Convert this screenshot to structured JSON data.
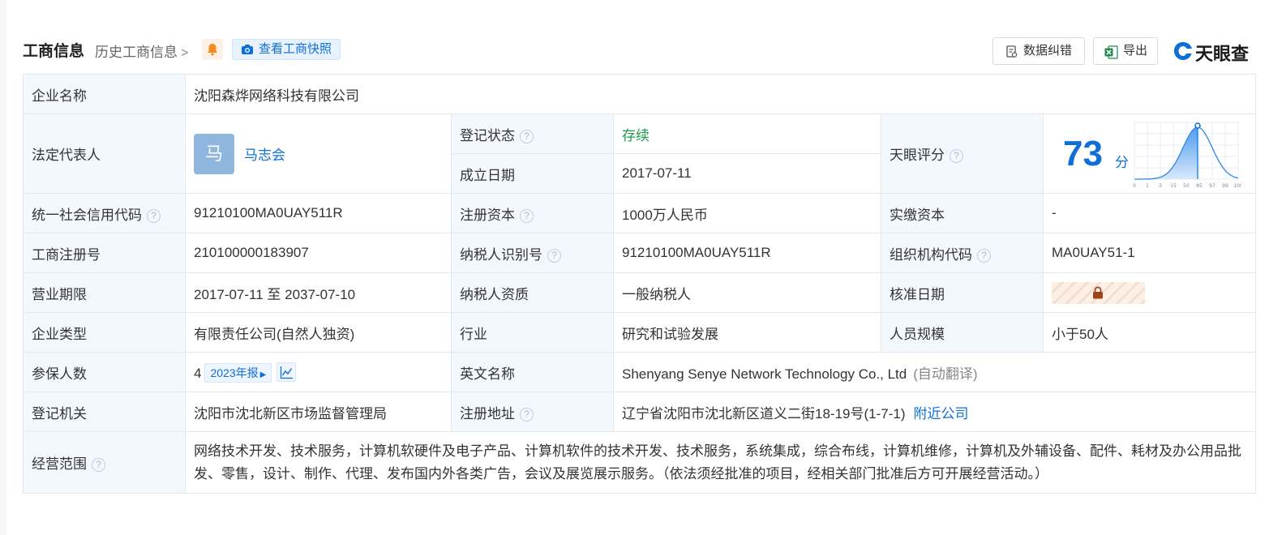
{
  "header": {
    "title": "工商信息",
    "history_link": "历史工商信息",
    "snapshot_btn": "查看工商快照",
    "correct_btn": "数据纠错",
    "export_btn": "导出",
    "logo_text": "天眼查"
  },
  "labels": {
    "company_name": "企业名称",
    "legal_rep": "法定代表人",
    "reg_status": "登记状态",
    "established": "成立日期",
    "tianyan_score": "天眼评分",
    "credit_code": "统一社会信用代码",
    "reg_capital": "注册资本",
    "paid_capital": "实缴资本",
    "reg_number": "工商注册号",
    "taxpayer_id": "纳税人识别号",
    "org_code": "组织机构代码",
    "term": "营业期限",
    "taxpayer_qual": "纳税人资质",
    "approval_date": "核准日期",
    "company_type": "企业类型",
    "industry": "行业",
    "staff_size": "人员规模",
    "insured": "参保人数",
    "english_name": "英文名称",
    "reg_authority": "登记机关",
    "reg_address": "注册地址",
    "business_scope": "经营范围"
  },
  "values": {
    "company_name": "沈阳森烨网络科技有限公司",
    "legal_rep_avatar": "马",
    "legal_rep_name": "马志会",
    "reg_status": "存续",
    "established": "2017-07-11",
    "score": "73",
    "score_unit": "分",
    "credit_code": "91210100MA0UAY511R",
    "reg_capital": "1000万人民币",
    "paid_capital": "-",
    "reg_number": "210100000183907",
    "taxpayer_id": "91210100MA0UAY511R",
    "org_code": "MA0UAY51-1",
    "term": "2017-07-11 至 2037-07-10",
    "taxpayer_qual": "一般纳税人",
    "company_type": "有限责任公司(自然人独资)",
    "industry": "研究和试验发展",
    "staff_size": "小于50人",
    "insured_count": "4",
    "insured_report": "2023年报",
    "english_name": "Shenyang Senye Network Technology Co., Ltd",
    "english_auto": "(自动翻译)",
    "reg_authority": "沈阳市沈北新区市场监督管理局",
    "reg_address": "辽宁省沈阳市沈北新区道义二街18-19号(1-7-1)",
    "nearby": "附近公司",
    "business_scope": "网络技术开发、技术服务，计算机软硬件及电子产品、计算机软件的技术开发、技术服务，系统集成，综合布线，计算机维修，计算机及外辅设备、配件、耗材及办公用品批发、零售，设计、制作、代理、发布国内外各类广告，会议及展览展示服务。（依法须经批准的项目，经相关部门批准后方可开展经营活动。）"
  },
  "chart_data": {
    "type": "area",
    "x_ticks": [
      "0",
      "1",
      "3",
      "15",
      "50",
      "85",
      "97",
      "99",
      "100"
    ],
    "marker_tick": "85",
    "score": 73,
    "ylim": [
      0,
      1
    ]
  },
  "colors": {
    "accent": "#0e6fd8",
    "status_active": "#1a9c4b",
    "label_bg": "#f2f8fe"
  }
}
